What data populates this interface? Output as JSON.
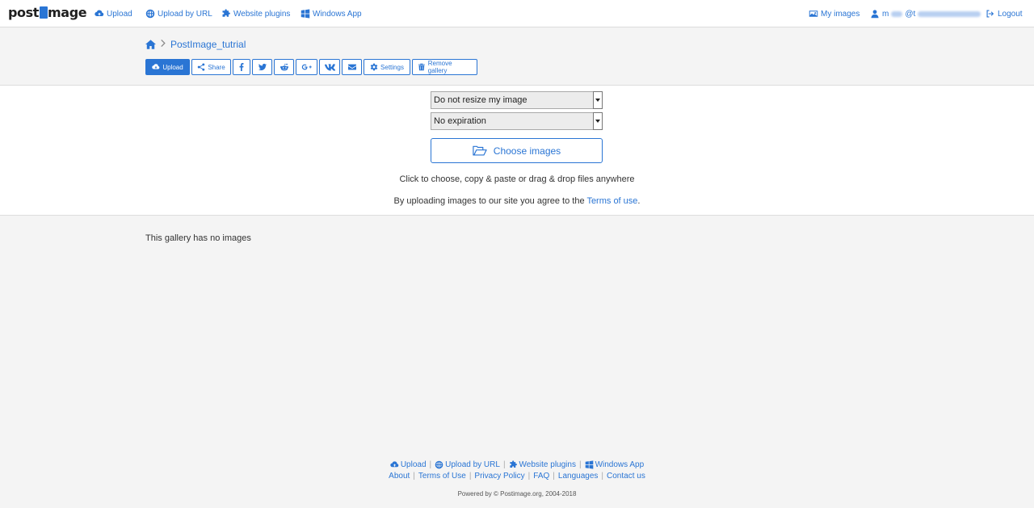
{
  "brand": {
    "name_pre": "post",
    "name_post": "mage"
  },
  "nav": {
    "upload": "Upload",
    "upload_url": "Upload by URL",
    "plugins": "Website plugins",
    "windows": "Windows App",
    "my_images": "My images",
    "email_visible": "m",
    "email_mid": "@t",
    "logout": "Logout"
  },
  "gallery": {
    "title": "PostImage_tutrial",
    "toolbar": {
      "upload": "Upload",
      "share": "Share",
      "settings": "Settings",
      "remove": "Remove gallery"
    }
  },
  "upload": {
    "resize": "Do not resize my image",
    "expiration": "No expiration",
    "choose": "Choose images",
    "hint": "Click to choose, copy & paste or drag & drop files anywhere",
    "terms_pre": "By uploading images to our site you agree to the ",
    "terms_link": "Terms of use",
    "terms_post": "."
  },
  "empty_message": "This gallery has no images",
  "footer": {
    "row1": [
      "Upload",
      "Upload by URL",
      "Website plugins",
      "Windows App"
    ],
    "row2": [
      "About",
      "Terms of Use",
      "Privacy Policy",
      "FAQ",
      "Languages",
      "Contact us"
    ],
    "copyright": "Powered by © Postimage.org, 2004-2018"
  },
  "colors": {
    "accent": "#2a75d4",
    "band": "#f4f4f4",
    "white": "#ffffff"
  }
}
